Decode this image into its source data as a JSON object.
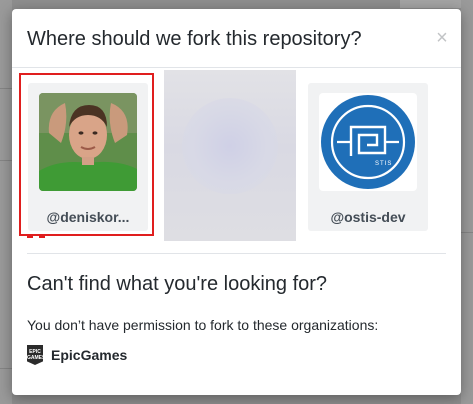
{
  "dialog": {
    "title": "Where should we fork this repository?",
    "close_label": "×"
  },
  "owners": [
    {
      "name": "@deniskor...",
      "selected": true
    },
    {
      "name": "@ostis-dev",
      "selected": false
    }
  ],
  "unavailable": {
    "heading": "Can't find what you're looking for?",
    "note": "You don’t have permission to fork to these organizations:",
    "organizations": [
      {
        "name": "EpicGames",
        "icon": "epic-games-logo",
        "icon_text": [
          "EPIC",
          "GAMES"
        ]
      }
    ]
  },
  "colors": {
    "selection_outline": "#e01e1e",
    "overlay": "#8e8e8e",
    "ostis_blue": "#1f6fb8"
  }
}
